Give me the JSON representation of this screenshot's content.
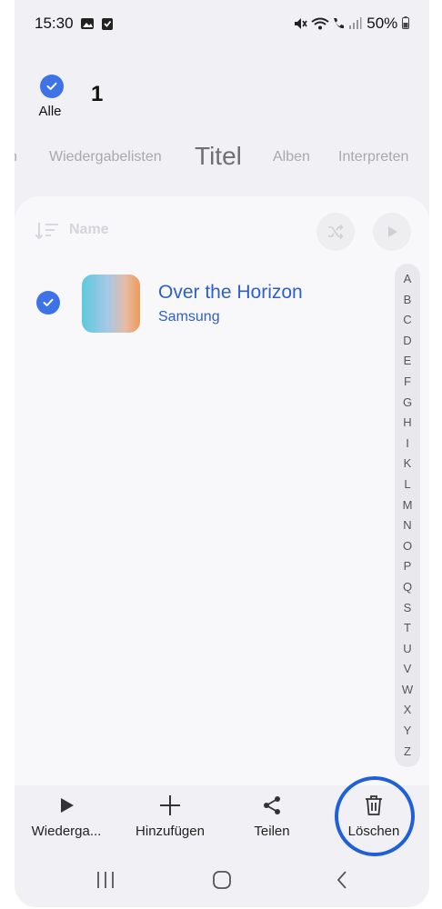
{
  "status_bar": {
    "time": "15:30",
    "battery": "50%",
    "icons": [
      "gallery-icon",
      "task-check-icon",
      "mute-icon",
      "wifi-icon",
      "wifi-call-icon",
      "signal-icon"
    ]
  },
  "selection": {
    "all_label": "Alle",
    "count": "1"
  },
  "tabs": [
    {
      "label": "n"
    },
    {
      "label": "Wiedergabelisten"
    },
    {
      "label": "Titel",
      "active": true
    },
    {
      "label": "Alben"
    },
    {
      "label": "Interpreten"
    }
  ],
  "list": {
    "sort_label": "Name",
    "tracks": [
      {
        "title": "Over the Horizon",
        "artist": "Samsung",
        "selected": true
      }
    ]
  },
  "alpha_index": [
    "A",
    "B",
    "C",
    "D",
    "E",
    "F",
    "G",
    "H",
    "I",
    "K",
    "L",
    "M",
    "N",
    "O",
    "P",
    "Q",
    "S",
    "T",
    "U",
    "V",
    "W",
    "X",
    "Y",
    "Z"
  ],
  "actions": [
    {
      "label": "Wiederga...",
      "icon": "play-icon"
    },
    {
      "label": "Hinzufügen",
      "icon": "plus-icon"
    },
    {
      "label": "Teilen",
      "icon": "share-icon"
    },
    {
      "label": "Löschen",
      "icon": "trash-icon",
      "highlighted": true
    }
  ],
  "colors": {
    "accent": "#3d73e6",
    "track_text": "#2f5fc6",
    "highlight_ring": "#1f5fd9"
  }
}
